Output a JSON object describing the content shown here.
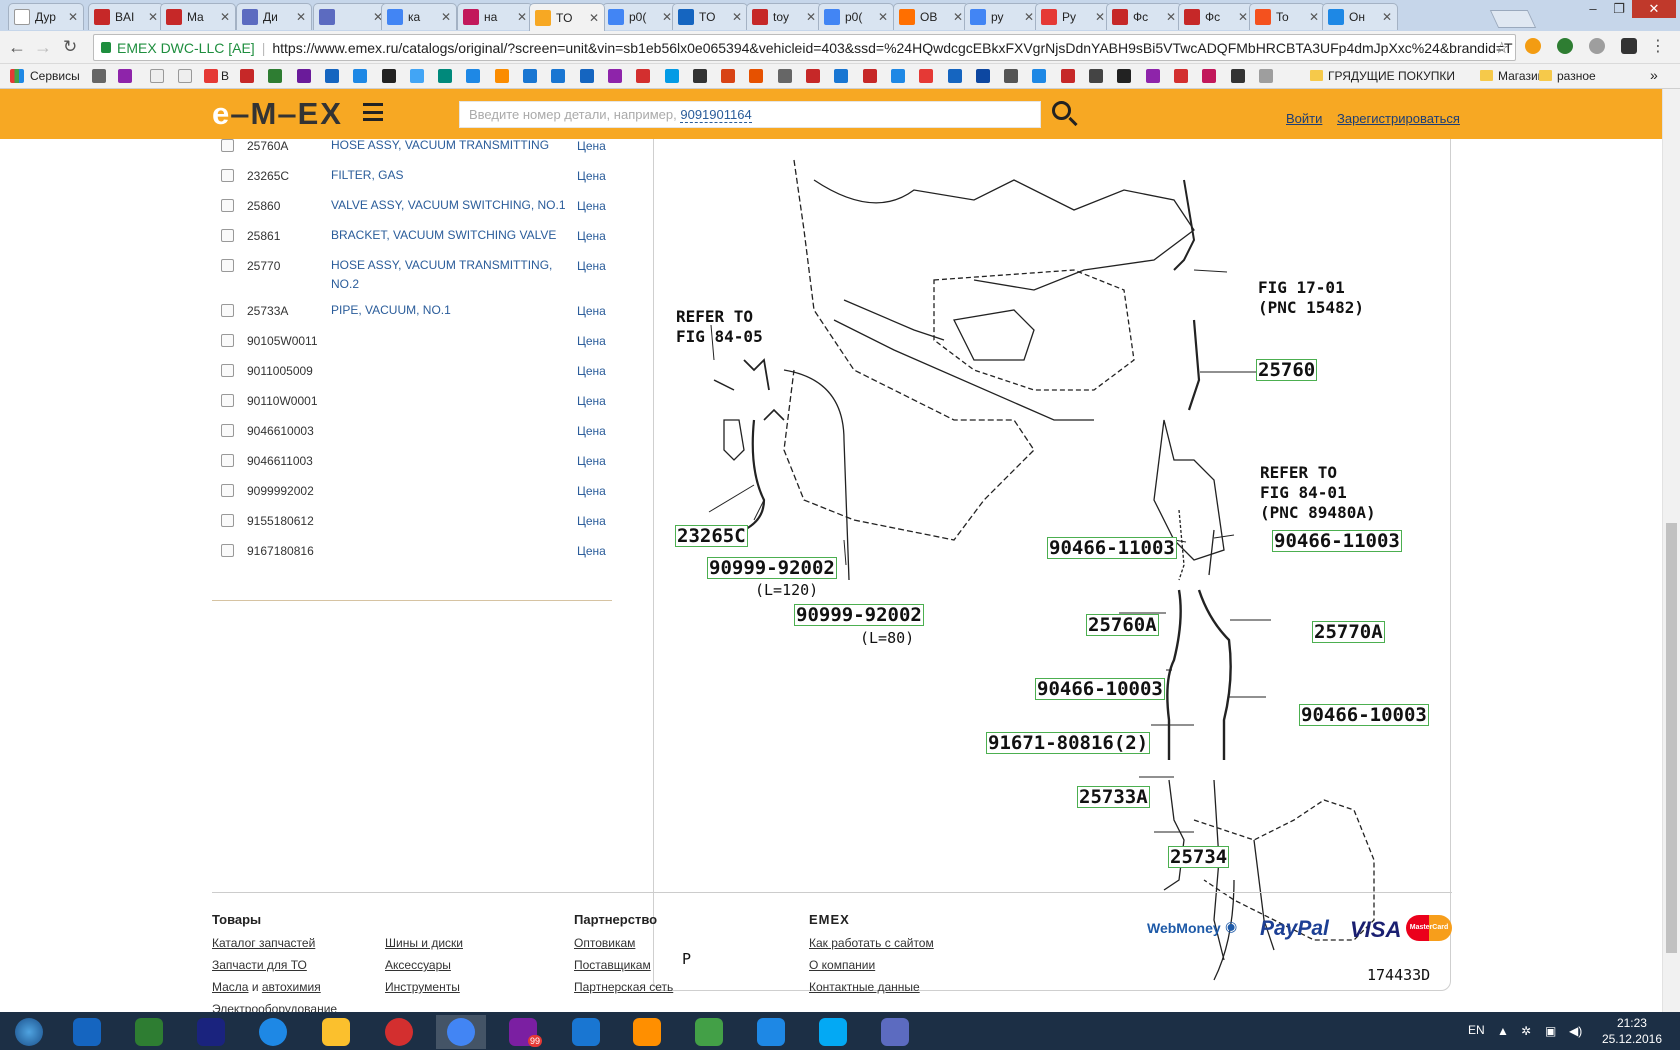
{
  "browser": {
    "tabs": [
      {
        "title": "Дур",
        "color": "#ffffff"
      },
      {
        "title": "BAI",
        "color": "#c62828"
      },
      {
        "title": "Ma",
        "color": "#c62828"
      },
      {
        "title": "Ди",
        "color": "#5c6bc0"
      },
      {
        "title": "",
        "color": "#5c6bc0"
      },
      {
        "title": "ка",
        "color": "#4285f4"
      },
      {
        "title": "на",
        "color": "#c2185b"
      },
      {
        "title": "TO",
        "color": "#f7a823"
      },
      {
        "title": "p0(",
        "color": "#4285f4"
      },
      {
        "title": "TO",
        "color": "#1565c0"
      },
      {
        "title": "toy",
        "color": "#c62828"
      },
      {
        "title": "p0(",
        "color": "#4285f4"
      },
      {
        "title": "OB",
        "color": "#ff6f00"
      },
      {
        "title": "ру",
        "color": "#4285f4"
      },
      {
        "title": "Ру",
        "color": "#e53935"
      },
      {
        "title": "Фс",
        "color": "#c62828"
      },
      {
        "title": "Фс",
        "color": "#c62828"
      },
      {
        "title": "To",
        "color": "#f4511e"
      },
      {
        "title": "Он",
        "color": "#1e88e5"
      }
    ],
    "org": "EMEX DWC-LLC [AE]",
    "url": "https://www.emex.ru/catalogs/original/?screen=unit&vin=sb1eb56lx0e065394&vehicleid=403&ssd=%24HQwdcgcEBkxFXVgrNjsDdnYABH9sBi5VTwcADQFMbHRCBTA3UFp4dmJpXxc%24&brandid=T",
    "bookmarks": {
      "services": "Сервисы",
      "b": "В",
      "folder1": "ГРЯДУЩИЕ ПОКУПКИ",
      "folder2": "Магазин",
      "folder3": "разное"
    }
  },
  "header": {
    "logo_prefix": "e",
    "logo_main": "M",
    "logo_rest": "EX",
    "search_placeholder": "Введите номер детали, например,",
    "search_example": "9091901164",
    "login": "Войти",
    "register": "Зарегистрироваться"
  },
  "parts": [
    {
      "num": "25760A",
      "name": "HOSE ASSY, VACUUM TRANSMITTING",
      "price": "Цена"
    },
    {
      "num": "23265C",
      "name": "FILTER, GAS",
      "price": "Цена"
    },
    {
      "num": "25860",
      "name": "VALVE ASSY, VACUUM SWITCHING, NO.1",
      "price": "Цена"
    },
    {
      "num": "25861",
      "name": "BRACKET, VACUUM SWITCHING VALVE",
      "price": "Цена"
    },
    {
      "num": "25770",
      "name": "HOSE ASSY, VACUUM TRANSMITTING, NO.2",
      "price": "Цена"
    },
    {
      "num": "25733A",
      "name": "PIPE, VACUUM, NO.1",
      "price": "Цена"
    },
    {
      "num": "90105W0011",
      "name": "",
      "price": "Цена"
    },
    {
      "num": "9011005009",
      "name": "",
      "price": "Цена"
    },
    {
      "num": "90110W0001",
      "name": "",
      "price": "Цена"
    },
    {
      "num": "9046610003",
      "name": "",
      "price": "Цена"
    },
    {
      "num": "9046611003",
      "name": "",
      "price": "Цена"
    },
    {
      "num": "9099992002",
      "name": "",
      "price": "Цена"
    },
    {
      "num": "9155180612",
      "name": "",
      "price": "Цена"
    },
    {
      "num": "9167180816",
      "name": "",
      "price": "Цена"
    }
  ],
  "diagram": {
    "callouts": {
      "c25760": "25760",
      "c23265C": "23265C",
      "c90999a": "90999-92002",
      "c90999b": "90999-92002",
      "c90466_11003a": "90466-11003",
      "c90466_11003b": "90466-11003",
      "c25760A": "25760A",
      "c25770A": "25770A",
      "c90466_10003a": "90466-10003",
      "c90466_10003b": "90466-10003",
      "c91671": "91671-80816(2)",
      "c25733A": "25733A",
      "c25734": "25734"
    },
    "notes": {
      "fig1701": "FIG 17-01\n(PNC 15482)",
      "ref8405": "REFER TO\nFIG 84-05",
      "ref8401": "REFER TO\nFIG 84-01\n(PNC 89480A)",
      "l120": "(L=120)",
      "l80": "(L=80)",
      "p": "P",
      "id": "174433D"
    }
  },
  "footer": {
    "col1_title": "Товары",
    "col1": [
      "Каталог запчастей",
      "Запчасти для ТО",
      "Масла",
      "автохимия",
      "Электрооборудование"
    ],
    "col1_and": "и",
    "col2": [
      "Шины и диски",
      "Аксессуары",
      "Инструменты"
    ],
    "col3_title": "Партнерство",
    "col3": [
      "Оптовикам",
      "Поставщикам",
      "Партнерская сеть"
    ],
    "col4_title": "EMEX",
    "col4": [
      "Как работать с сайтом",
      "О компании",
      "Контактные данные"
    ],
    "payments": {
      "webmoney": "WebMoney",
      "paypal": "PayPal",
      "visa": "VISA",
      "mastercard": "MasterCard"
    }
  },
  "taskbar": {
    "lang": "EN",
    "time": "21:23",
    "date": "25.12.2016",
    "viber_badge": "99"
  }
}
